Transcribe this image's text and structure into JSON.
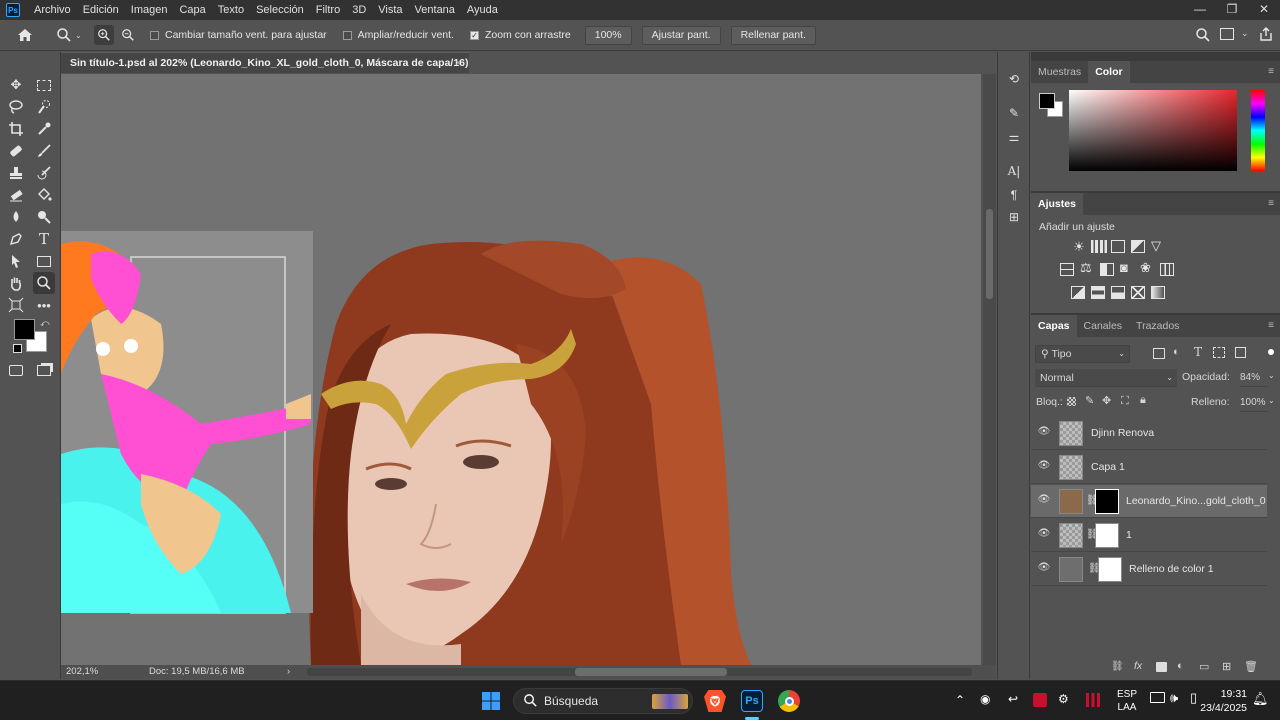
{
  "app": {
    "logo": "Ps"
  },
  "menu": [
    "Archivo",
    "Edición",
    "Imagen",
    "Capa",
    "Texto",
    "Selección",
    "Filtro",
    "3D",
    "Vista",
    "Ventana",
    "Ayuda"
  ],
  "options_bar": {
    "resize_windows": "Cambiar tamaño vent. para ajustar",
    "zoom_all": "Ampliar/reducir vent.",
    "scrubby_zoom": "Zoom con arrastre",
    "zoom_value": "100%",
    "fit_screen": "Ajustar pant.",
    "fill_screen": "Rellenar pant."
  },
  "document_tab": {
    "title": "Sin título-1.psd al 202% (Leonardo_Kino_XL_gold_cloth_0, Máscara de capa/16) *",
    "close": "×"
  },
  "status": {
    "zoom": "202,1%",
    "doc": "Doc: 19,5 MB/16,6 MB",
    "arrow": "›"
  },
  "color_panel": {
    "tabs": [
      "Muestras",
      "Color"
    ],
    "active_tab": "Color",
    "fg": "#000000",
    "bg": "#ffffff",
    "hue": "#e8262c"
  },
  "adjustments_panel": {
    "title": "Ajustes",
    "subtitle": "Añadir un ajuste"
  },
  "layers_panel": {
    "tabs": [
      "Capas",
      "Canales",
      "Trazados"
    ],
    "active_tab": "Capas",
    "filter": "Tipo",
    "blend_mode": "Normal",
    "opacity_label": "Opacidad:",
    "opacity_value": "84%",
    "lock_label": "Bloq.:",
    "fill_label": "Relleno:",
    "fill_value": "100%",
    "layers": [
      {
        "name": "Djinn Renova",
        "selected": false,
        "mask": "none"
      },
      {
        "name": "Capa 1",
        "selected": false,
        "mask": "none"
      },
      {
        "name": "Leonardo_Kino...gold_cloth_0",
        "selected": true,
        "mask": "black"
      },
      {
        "name": "1",
        "selected": false,
        "mask": "white-shape"
      },
      {
        "name": "Relleno de color 1",
        "selected": false,
        "mask": "white"
      }
    ]
  },
  "taskbar": {
    "search": "Búsqueda",
    "lang_top": "ESP",
    "lang_bottom": "LAA",
    "time": "19:31",
    "date": "23/4/2025"
  }
}
